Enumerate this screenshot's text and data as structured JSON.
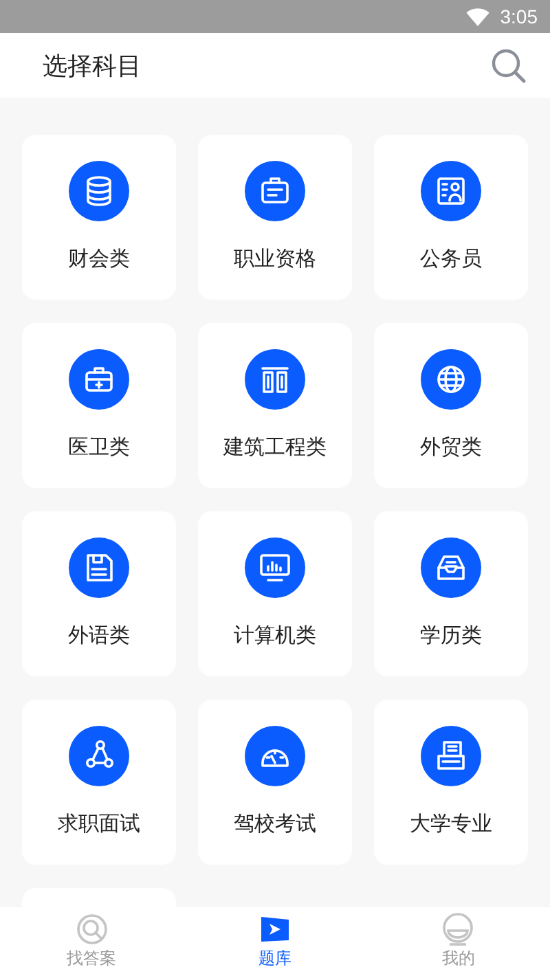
{
  "status_bar": {
    "time": "3:05"
  },
  "header": {
    "title": "选择科目"
  },
  "subjects": [
    {
      "label": "财会类"
    },
    {
      "label": "职业资格"
    },
    {
      "label": "公务员"
    },
    {
      "label": "医卫类"
    },
    {
      "label": "建筑工程类"
    },
    {
      "label": "外贸类"
    },
    {
      "label": "外语类"
    },
    {
      "label": "计算机类"
    },
    {
      "label": "学历类"
    },
    {
      "label": "求职面试"
    },
    {
      "label": "驾校考试"
    },
    {
      "label": "大学专业"
    }
  ],
  "tabs": [
    {
      "label": "找答案",
      "selected": false
    },
    {
      "label": "题库",
      "selected": true
    },
    {
      "label": "我的",
      "selected": false
    }
  ]
}
